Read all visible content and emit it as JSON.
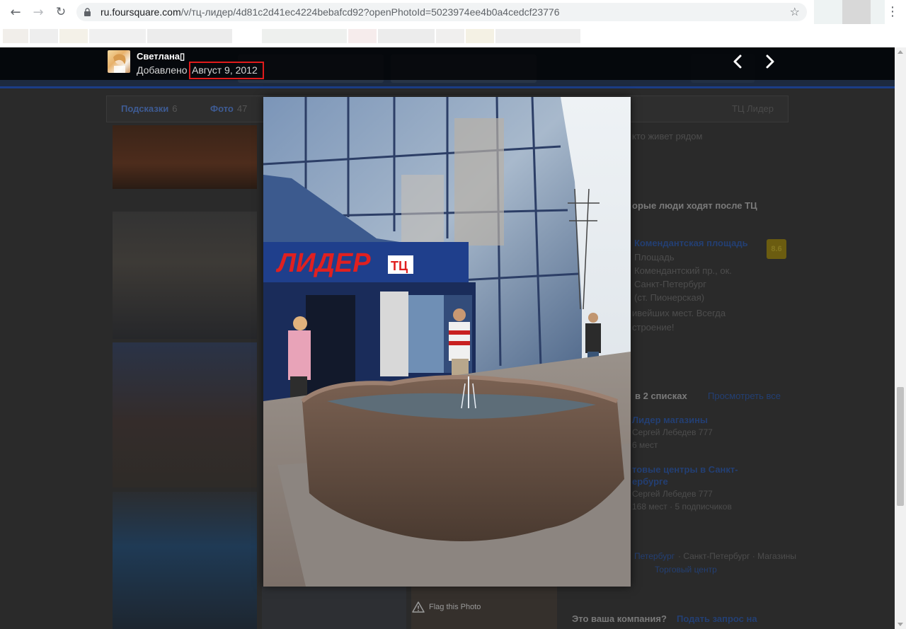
{
  "browser": {
    "url_host": "ru.foursquare.com",
    "url_path": "/v/тц-лидер/4d81c2d41ec4224bebafcd92?openPhotoId=5023974ee4b0a4cedcf23776",
    "back_icon": "←",
    "forward_icon": "→",
    "reload_icon": "↻",
    "star_icon": "☆",
    "menu_icon": "⋮"
  },
  "lightbox": {
    "uploader_name": "Светлана",
    "uploader_suffix": "▯",
    "added_prefix": "Добавлено",
    "added_date": "Август 9, 2012",
    "flag_label": "Flag this Photo",
    "highlight_color": "#e01b1b"
  },
  "page": {
    "tabs": [
      {
        "label": "Подсказки",
        "count": "6"
      },
      {
        "label": "Фото",
        "count": "47"
      }
    ],
    "venue_tab": "ТЦ Лидер",
    "right_column": {
      "tip_fragment": "кто живет рядом",
      "people_heading": "орые люди ходят после ТЦ",
      "nearby_venue": "Комендантская площадь",
      "nearby_lines": [
        "Площадь",
        "Комендантский пр., ок.",
        "Санкт-Петербург",
        "(ст. Пионерская)"
      ],
      "quote_lines": [
        "ивейших мест. Всегда",
        "строение!"
      ],
      "rating_badge": "8.6",
      "lists_heading": "в 2 списках",
      "lists_view_all": "Просмотреть все",
      "lists": [
        {
          "title": "Лидер магазины",
          "meta": [
            "Сергей Лебедев 777",
            "6 мест"
          ]
        },
        {
          "title": "товые центры в Санкт-",
          "title2": "ербурге",
          "meta": [
            "Сергей Лебедев 777",
            "168 мест · 5 подписчиков"
          ]
        }
      ],
      "breadcrumb_city": "Петербург",
      "breadcrumb_rest": "· Санкт-Петербург · Магазины",
      "breadcrumb_cat": "Торговый центр",
      "claim_text": "Это ваша компания?",
      "claim_link": "Подать запрос на"
    }
  },
  "colors": {
    "overlay_header": "#000000",
    "highlight_box": "#e01b1b",
    "page_link_dim": "#233f73"
  }
}
